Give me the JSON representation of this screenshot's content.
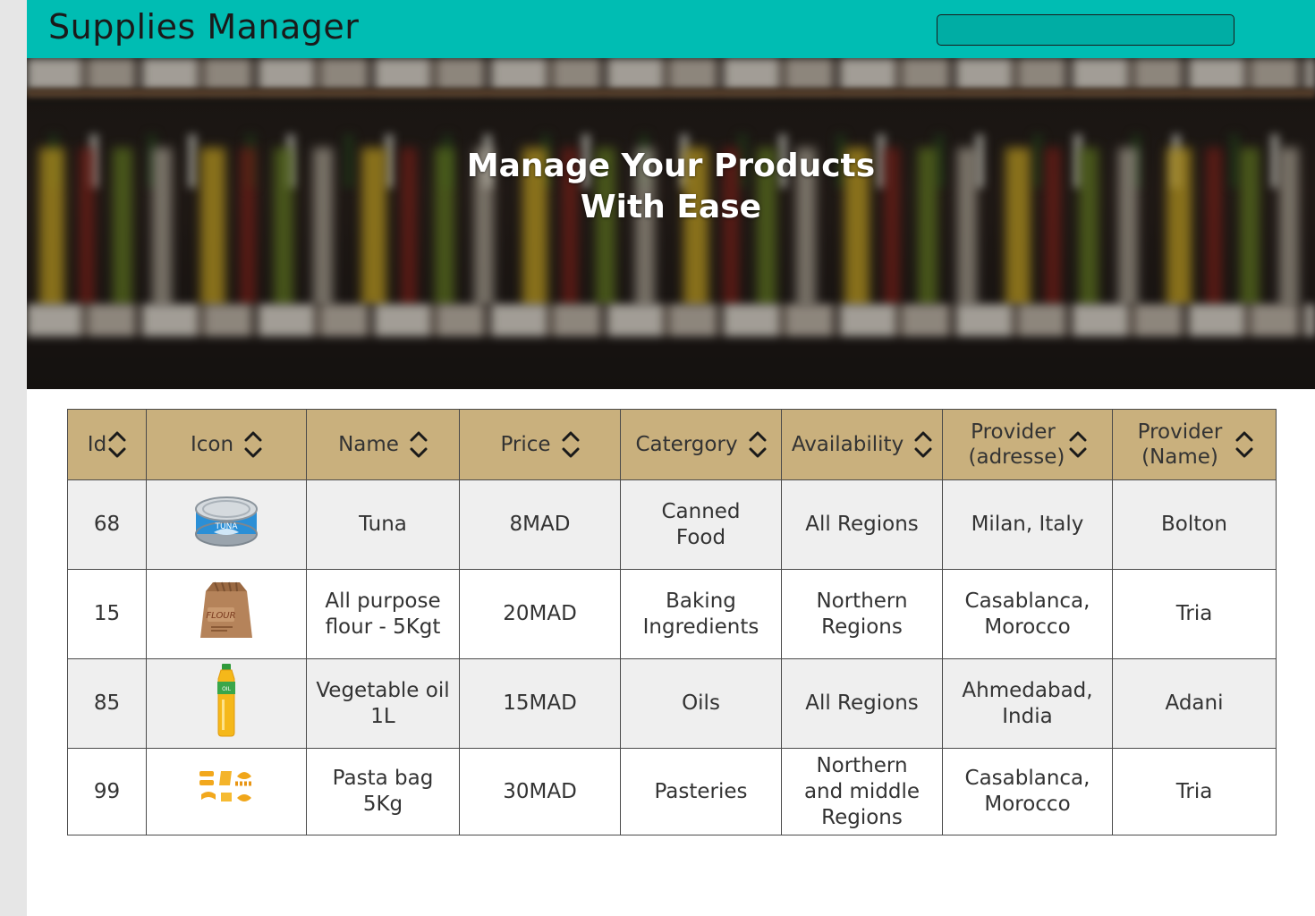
{
  "app": {
    "title": "Supplies Manager"
  },
  "search": {
    "value": "",
    "placeholder": ""
  },
  "hero": {
    "title_line1": "Manage Your Products",
    "title_line2": "With Ease"
  },
  "table": {
    "columns": [
      {
        "label": "Id",
        "sort_icon": "sort-icon"
      },
      {
        "label": "Icon",
        "sort_icon": "sort-icon"
      },
      {
        "label": "Name",
        "sort_icon": "sort-icon"
      },
      {
        "label": "Price",
        "sort_icon": "sort-icon"
      },
      {
        "label": "Catergory",
        "sort_icon": "sort-icon"
      },
      {
        "label": "Availability",
        "sort_icon": "sort-icon"
      },
      {
        "label": "Provider (adresse)",
        "sort_icon": "sort-icon"
      },
      {
        "label": "Provider (Name)",
        "sort_icon": "sort-icon"
      }
    ],
    "rows": [
      {
        "id": "68",
        "icon": "tuna-can-icon",
        "name": "Tuna",
        "price": "8MAD",
        "category": "Canned Food",
        "availability": "All Regions",
        "provider_address": "Milan, Italy",
        "provider_name": "Bolton"
      },
      {
        "id": "15",
        "icon": "flour-bag-icon",
        "name": "All purpose flour - 5Kgt",
        "price": "20MAD",
        "category": "Baking Ingredients",
        "availability": "Northern Regions",
        "provider_address": "Casablanca, Morocco",
        "provider_name": "Tria"
      },
      {
        "id": "85",
        "icon": "oil-bottle-icon",
        "name": "Vegetable oil 1L",
        "price": "15MAD",
        "category": "Oils",
        "availability": "All Regions",
        "provider_address": "Ahmedabad, India",
        "provider_name": "Adani"
      },
      {
        "id": "99",
        "icon": "pasta-icon",
        "name": "Pasta bag 5Kg",
        "price": "30MAD",
        "category": "Pasteries",
        "availability": "Northern and middle Regions",
        "provider_address": "Casablanca, Morocco",
        "provider_name": "Tria"
      }
    ]
  },
  "icon_labels": {
    "tuna": "TUNA",
    "flour": "FLOUR",
    "oil": "OIL"
  },
  "colors": {
    "topbar": "#00bdb3",
    "table_header": "#c9b07d",
    "row_alt": "#efefef"
  }
}
